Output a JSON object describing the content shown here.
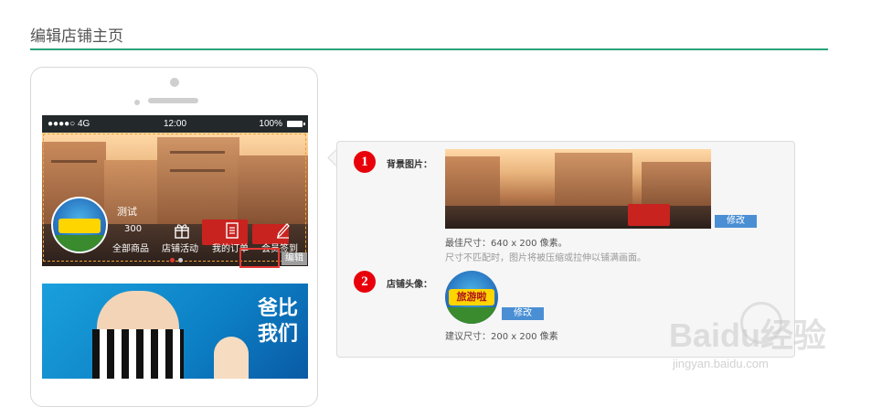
{
  "page": {
    "title": "编辑店铺主页"
  },
  "phone": {
    "status": {
      "signal": "●●●●○ 4G",
      "time": "12:00",
      "battery": "100%"
    },
    "shop": {
      "name": "测试",
      "count": "300",
      "nav": [
        {
          "label": "全部商品",
          "icon": "grid-icon"
        },
        {
          "label": "店铺活动",
          "icon": "gift-icon"
        },
        {
          "label": "我的订单",
          "icon": "order-list-icon"
        },
        {
          "label": "会员签到",
          "icon": "pencil-icon"
        }
      ],
      "edit_label": "编辑"
    },
    "ad": {
      "text": "爸比我们"
    },
    "colors": {
      "dashed_border": "#f0a030",
      "edit_highlight": "#e53935"
    }
  },
  "panel": {
    "background": {
      "number": "1",
      "label": "背景图片：",
      "modify_label": "修改",
      "best_size": "最佳尺寸：640 x 200 像素。",
      "mismatch_hint": "尺寸不匹配时，图片将被压缩或拉伸以铺满画面。"
    },
    "avatar": {
      "number": "2",
      "label": "店铺头像：",
      "avatar_text": "旅游啦",
      "modify_label": "修改",
      "suggested_size": "建议尺寸：200 x 200 像素"
    }
  },
  "watermark": {
    "brand": "Baidu经验",
    "url": "jingyan.baidu.com"
  },
  "theme": {
    "accent": "#2aa37a",
    "badge": "#e8000b",
    "button": "#4a8fd4"
  }
}
